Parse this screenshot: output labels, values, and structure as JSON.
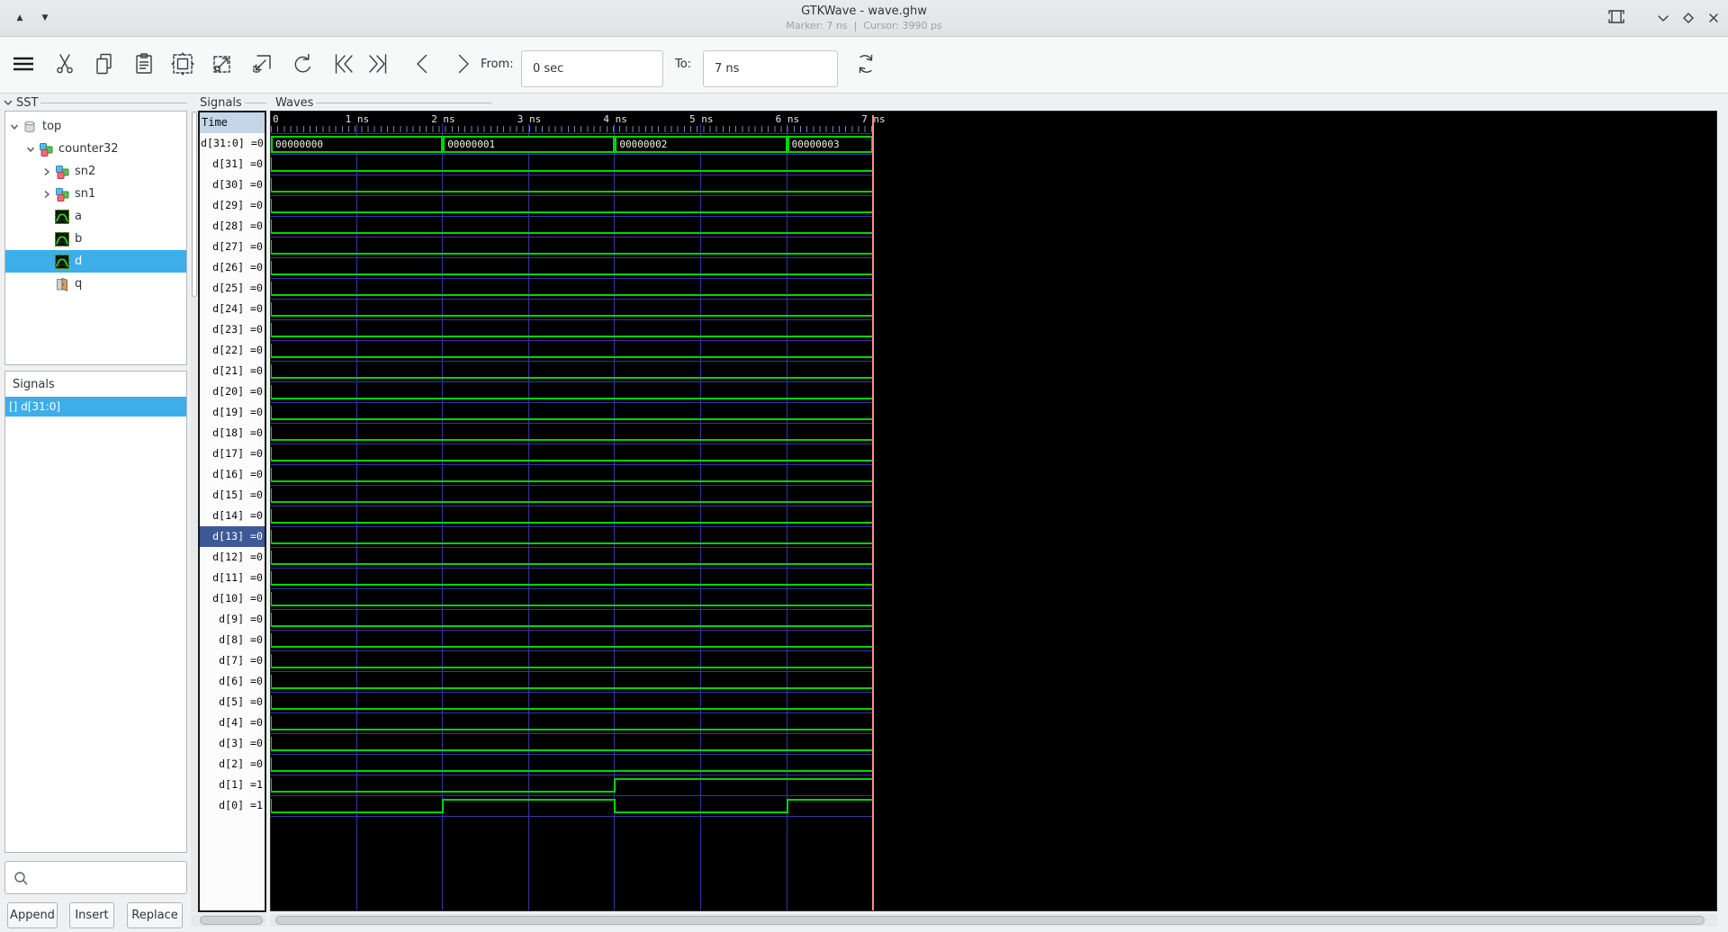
{
  "window": {
    "title": "GTKWave - wave.ghw",
    "status_marker": "Marker: 7 ns",
    "status_separator": "|",
    "status_cursor": "Cursor: 3990 ps"
  },
  "toolbar": {
    "from_label": "From:",
    "from_value": "0 sec",
    "to_label": "To:",
    "to_value": "7 ns"
  },
  "sst": {
    "frame_label": "SST",
    "items": [
      {
        "label": "top",
        "depth": 0,
        "icon": "module",
        "expander": "open"
      },
      {
        "label": "counter32",
        "depth": 1,
        "icon": "hierarchy",
        "expander": "open"
      },
      {
        "label": "sn2",
        "depth": 2,
        "icon": "hierarchy",
        "expander": "closed"
      },
      {
        "label": "sn1",
        "depth": 2,
        "icon": "hierarchy",
        "expander": "closed"
      },
      {
        "label": "a",
        "depth": 2,
        "icon": "signal"
      },
      {
        "label": "b",
        "depth": 2,
        "icon": "signal"
      },
      {
        "label": "d",
        "depth": 2,
        "icon": "signal",
        "selected": true
      },
      {
        "label": "q",
        "depth": 2,
        "icon": "port"
      }
    ]
  },
  "signal_list": {
    "frame_label": "Signals",
    "items": [
      {
        "label": "[] d[31:0]",
        "selected": true
      }
    ],
    "search_placeholder": "",
    "buttons": [
      "Append",
      "Insert",
      "Replace"
    ]
  },
  "signals_panel": {
    "frame_label": "Signals",
    "time_header": "Time",
    "rows": [
      {
        "label": "d[31:0] =0",
        "type": "bus"
      },
      {
        "label": "d[31] =0",
        "bit": 31
      },
      {
        "label": "d[30] =0",
        "bit": 30
      },
      {
        "label": "d[29] =0",
        "bit": 29
      },
      {
        "label": "d[28] =0",
        "bit": 28
      },
      {
        "label": "d[27] =0",
        "bit": 27
      },
      {
        "label": "d[26] =0",
        "bit": 26
      },
      {
        "label": "d[25] =0",
        "bit": 25
      },
      {
        "label": "d[24] =0",
        "bit": 24
      },
      {
        "label": "d[23] =0",
        "bit": 23
      },
      {
        "label": "d[22] =0",
        "bit": 22
      },
      {
        "label": "d[21] =0",
        "bit": 21
      },
      {
        "label": "d[20] =0",
        "bit": 20
      },
      {
        "label": "d[19] =0",
        "bit": 19
      },
      {
        "label": "d[18] =0",
        "bit": 18
      },
      {
        "label": "d[17] =0",
        "bit": 17
      },
      {
        "label": "d[16] =0",
        "bit": 16
      },
      {
        "label": "d[15] =0",
        "bit": 15
      },
      {
        "label": "d[14] =0",
        "bit": 14
      },
      {
        "label": "d[13] =0",
        "bit": 13,
        "selected": true
      },
      {
        "label": "d[12] =0",
        "bit": 12
      },
      {
        "label": "d[11] =0",
        "bit": 11
      },
      {
        "label": "d[10] =0",
        "bit": 10
      },
      {
        "label": "d[9] =0",
        "bit": 9
      },
      {
        "label": "d[8] =0",
        "bit": 8
      },
      {
        "label": "d[7] =0",
        "bit": 7
      },
      {
        "label": "d[6] =0",
        "bit": 6
      },
      {
        "label": "d[5] =0",
        "bit": 5
      },
      {
        "label": "d[4] =0",
        "bit": 4
      },
      {
        "label": "d[3] =0",
        "bit": 3
      },
      {
        "label": "d[2] =0",
        "bit": 2
      },
      {
        "label": "d[1] =1",
        "bit": 1
      },
      {
        "label": "d[0] =1",
        "bit": 0
      }
    ]
  },
  "waves": {
    "frame_label": "Waves",
    "timeline": {
      "origin": "0",
      "ticks": [
        "1 ns",
        "2 ns",
        "3 ns",
        "4 ns",
        "5 ns",
        "6 ns",
        "7 ns"
      ]
    },
    "marker_ns": 7,
    "bus_segments": [
      {
        "t0": 0,
        "t1": 2,
        "value": "00000000"
      },
      {
        "t0": 2,
        "t1": 4,
        "value": "00000001"
      },
      {
        "t0": 4,
        "t1": 6,
        "value": "00000002"
      },
      {
        "t0": 6,
        "t1": 7,
        "value": "00000003"
      }
    ],
    "bit_waves": [
      {
        "bit": 31,
        "segments": [
          [
            0,
            7,
            0
          ]
        ]
      },
      {
        "bit": 30,
        "segments": [
          [
            0,
            7,
            0
          ]
        ]
      },
      {
        "bit": 29,
        "segments": [
          [
            0,
            7,
            0
          ]
        ]
      },
      {
        "bit": 28,
        "segments": [
          [
            0,
            7,
            0
          ]
        ]
      },
      {
        "bit": 27,
        "segments": [
          [
            0,
            7,
            0
          ]
        ]
      },
      {
        "bit": 26,
        "segments": [
          [
            0,
            7,
            0
          ]
        ]
      },
      {
        "bit": 25,
        "segments": [
          [
            0,
            7,
            0
          ]
        ]
      },
      {
        "bit": 24,
        "segments": [
          [
            0,
            7,
            0
          ]
        ]
      },
      {
        "bit": 23,
        "segments": [
          [
            0,
            7,
            0
          ]
        ]
      },
      {
        "bit": 22,
        "segments": [
          [
            0,
            7,
            0
          ]
        ]
      },
      {
        "bit": 21,
        "segments": [
          [
            0,
            7,
            0
          ]
        ]
      },
      {
        "bit": 20,
        "segments": [
          [
            0,
            7,
            0
          ]
        ]
      },
      {
        "bit": 19,
        "segments": [
          [
            0,
            7,
            0
          ]
        ]
      },
      {
        "bit": 18,
        "segments": [
          [
            0,
            7,
            0
          ]
        ]
      },
      {
        "bit": 17,
        "segments": [
          [
            0,
            7,
            0
          ]
        ]
      },
      {
        "bit": 16,
        "segments": [
          [
            0,
            7,
            0
          ]
        ]
      },
      {
        "bit": 15,
        "segments": [
          [
            0,
            7,
            0
          ]
        ]
      },
      {
        "bit": 14,
        "segments": [
          [
            0,
            7,
            0
          ]
        ]
      },
      {
        "bit": 13,
        "segments": [
          [
            0,
            7,
            0
          ]
        ]
      },
      {
        "bit": 12,
        "segments": [
          [
            0,
            7,
            0
          ]
        ]
      },
      {
        "bit": 11,
        "segments": [
          [
            0,
            7,
            0
          ]
        ]
      },
      {
        "bit": 10,
        "segments": [
          [
            0,
            7,
            0
          ]
        ]
      },
      {
        "bit": 9,
        "segments": [
          [
            0,
            7,
            0
          ]
        ]
      },
      {
        "bit": 8,
        "segments": [
          [
            0,
            7,
            0
          ]
        ]
      },
      {
        "bit": 7,
        "segments": [
          [
            0,
            7,
            0
          ]
        ]
      },
      {
        "bit": 6,
        "segments": [
          [
            0,
            7,
            0
          ]
        ]
      },
      {
        "bit": 5,
        "segments": [
          [
            0,
            7,
            0
          ]
        ]
      },
      {
        "bit": 4,
        "segments": [
          [
            0,
            7,
            0
          ]
        ]
      },
      {
        "bit": 3,
        "segments": [
          [
            0,
            7,
            0
          ]
        ]
      },
      {
        "bit": 2,
        "segments": [
          [
            0,
            7,
            0
          ]
        ]
      },
      {
        "bit": 1,
        "segments": [
          [
            0,
            4,
            0
          ],
          [
            4,
            7,
            1
          ]
        ]
      },
      {
        "bit": 0,
        "segments": [
          [
            0,
            2,
            0
          ],
          [
            2,
            4,
            1
          ],
          [
            4,
            6,
            0
          ],
          [
            6,
            7,
            1
          ]
        ]
      }
    ],
    "colors": {
      "trace_green": "#00d400",
      "grid_blue": "#3535a5",
      "marker_red": "#ff8a8a",
      "background": "#000000",
      "value_text": "#f2f2f2"
    }
  },
  "colors": {
    "selection_azure": "#3daee9",
    "selection_navy": "#3b5a97",
    "time_header_bg": "#c4d6e7"
  }
}
